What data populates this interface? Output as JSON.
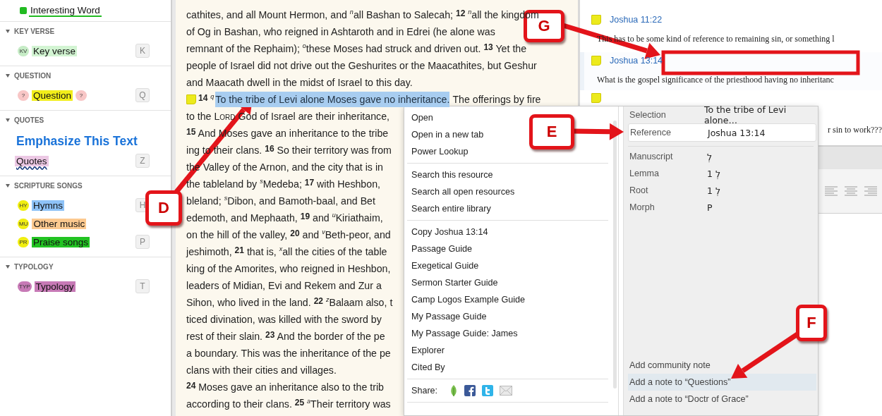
{
  "sidebar": {
    "top_item": {
      "label": "Interesting Word",
      "kind": "underline",
      "color": "#22bb22"
    },
    "sections": [
      {
        "title": "KEY VERSE",
        "expanded": true,
        "items": [
          {
            "label": "Key verse",
            "kind": "highlight",
            "color": "#d2f4d2",
            "badge": {
              "text": "KV",
              "color": "#c6ecc6"
            },
            "key": "K"
          }
        ]
      },
      {
        "title": "QUESTION",
        "expanded": true,
        "items": [
          {
            "label": "Question",
            "kind": "highlight",
            "color": "#f2ee1a",
            "badge": {
              "text": "?",
              "color": "#f8c6c6"
            },
            "badge_after": {
              "text": "?",
              "color": "#f8c6c6"
            },
            "key": "Q"
          }
        ]
      },
      {
        "title": "QUOTES",
        "expanded": true,
        "items": [
          {
            "label": "Emphasize This Text",
            "kind": "emphasis",
            "color": "#1a73d9"
          },
          {
            "label": "Quotes",
            "kind": "wavy",
            "color": "#ecc8e4",
            "key": "Z"
          }
        ]
      },
      {
        "title": "SCRIPTURE SONGS",
        "expanded": true,
        "items": [
          {
            "label": "Hymns",
            "kind": "highlight",
            "color": "#8ec2f7",
            "badge": {
              "text": "HY",
              "color": "#f0ee10"
            },
            "key": "H"
          },
          {
            "label": "Other music",
            "kind": "highlight",
            "color": "#fcc98f",
            "badge": {
              "text": "MU",
              "color": "#f0ee10"
            }
          },
          {
            "label": "Praise songs",
            "kind": "highlight",
            "color": "#22c322",
            "badge": {
              "text": "PR",
              "color": "#f0ee10"
            },
            "key": "P"
          }
        ]
      },
      {
        "title": "TYPOLOGY",
        "expanded": true,
        "items": [
          {
            "label": "Typology",
            "kind": "highlight",
            "color": "#c77ab6",
            "badge": {
              "text": "TYP",
              "color": "#c77ab6"
            },
            "key": "T"
          }
        ]
      }
    ]
  },
  "passage": {
    "lines": [
      {
        "kind": "text",
        "text": "cathites, and all Mount Hermon, and $^{n}$all Bashan to Salecah; **$^{12}$** $^{n}$all the kingdom"
      },
      {
        "kind": "text",
        "text": "of Og in Bashan, who reigned in Ashtaroth and in Edrei (he alone was"
      },
      {
        "kind": "text",
        "text": "remnant of the Rephaim); $^{o}$these Moses had struck and driven out. **$^{13}$** Yet the"
      },
      {
        "kind": "text",
        "text": "people of Israel did not drive out the Geshurites or the Maacathites, but Geshur"
      },
      {
        "kind": "text",
        "text": "and Maacath dwell in the midst of Israel to this day."
      },
      {
        "kind": "selection",
        "note": true,
        "verse": "**$^{14}$** $^{q}$",
        "selected_text": "To the tribe of Levi alone Moses gave no inheritance.",
        "rest": "The offerings by fire"
      },
      {
        "kind": "smallcaps",
        "before": "to the",
        "small": "Lord",
        "after": "God of Israel are their inheritance,"
      },
      {
        "kind": "text",
        "text": "**$^{15}$** And Moses gave an inheritance to the tribe"
      },
      {
        "kind": "text",
        "text": "ing to their clans. **$^{16}$** So their territory was from"
      },
      {
        "kind": "text",
        "text": "the Valley of the Arnon, and the city that is in"
      },
      {
        "kind": "text",
        "text": "the tableland by $^{s}$Medeba; **$^{17}$** with Heshbon,"
      },
      {
        "kind": "text",
        "text": "bleland; $^{s}$Dibon, and Bamoth-baal, and Bet"
      },
      {
        "kind": "text",
        "text": "edemoth, and Mephaath, **$^{19}$** and $^{u}$Kiriathaim,"
      },
      {
        "kind": "text",
        "text": "on the hill of the valley, **$^{20}$** and $^{v}$Beth-peor, and"
      },
      {
        "kind": "text",
        "text": "jeshimoth, **$^{21}$** that is, $^{x}$all the cities of the table"
      },
      {
        "kind": "text",
        "text": "king of the Amorites, who reigned in Heshbon,"
      },
      {
        "kind": "text",
        "text": "leaders of Midian, Evi and Rekem and Zur a"
      },
      {
        "kind": "text",
        "text": "Sihon, who lived in the land. **$^{22}$** $^{z}$Balaam also, t"
      },
      {
        "kind": "text",
        "text": "ticed divination, was killed with the sword by"
      },
      {
        "kind": "text",
        "text": "rest of their slain. **$^{23}$** And the border of the pe"
      },
      {
        "kind": "text",
        "text": "a boundary. This was the inheritance of the pe"
      },
      {
        "kind": "text",
        "text": "clans with their cities and villages."
      },
      {
        "kind": "text",
        "text": "**$^{24}$** Moses gave an inheritance also to the trib"
      },
      {
        "kind": "text",
        "text": "according to their clans. **$^{25}$** $^{a}$Their territory was"
      }
    ]
  },
  "notes": [
    {
      "reference": "Joshua 11:22",
      "text": "This has to be some kind of reference to remaining sin, or something l",
      "selected": false
    },
    {
      "reference": "Joshua 13:14",
      "text": "What is the gospel significance of the priesthood having no inheritanc",
      "selected": true
    },
    {
      "text": "r sin to work???",
      "selected": false
    }
  ],
  "context_menu": {
    "groups": [
      [
        "Open",
        "Open in a new tab",
        "Power Lookup"
      ],
      [
        "Search this resource",
        "Search all open resources",
        "Search entire library"
      ],
      [
        "Copy Joshua 13:14",
        "Passage Guide",
        "Exegetical Guide",
        "Sermon Starter Guide",
        "Camp Logos Example Guide",
        "My Passage Guide",
        "My Passage Guide: James",
        "Explorer",
        "Cited By"
      ]
    ],
    "share_label": "Share:",
    "properties": [
      {
        "label": "Selection",
        "value": "To the tribe of Levi alone…",
        "selected": false
      },
      {
        "label": "Reference",
        "value": "Joshua 13:14",
        "selected": true
      },
      {
        "label": "Manuscript",
        "value": "לְ",
        "selected": false
      },
      {
        "label": "Lemma",
        "value": "1 לְ",
        "selected": false
      },
      {
        "label": "Root",
        "value": "1 לְ",
        "selected": false
      },
      {
        "label": "Morph",
        "value": "P",
        "selected": false
      }
    ],
    "actions": [
      {
        "label": "Add community note",
        "selected": false
      },
      {
        "label": "Add a note to “Questions”",
        "selected": true
      },
      {
        "label": "Add a note to “Doctr of Grace”",
        "selected": false
      }
    ]
  },
  "callouts": [
    {
      "label": "D",
      "kind": "arrow"
    },
    {
      "label": "E",
      "kind": "arrow"
    },
    {
      "label": "F",
      "kind": "arrow"
    },
    {
      "label": "G",
      "kind": "frame"
    }
  ]
}
